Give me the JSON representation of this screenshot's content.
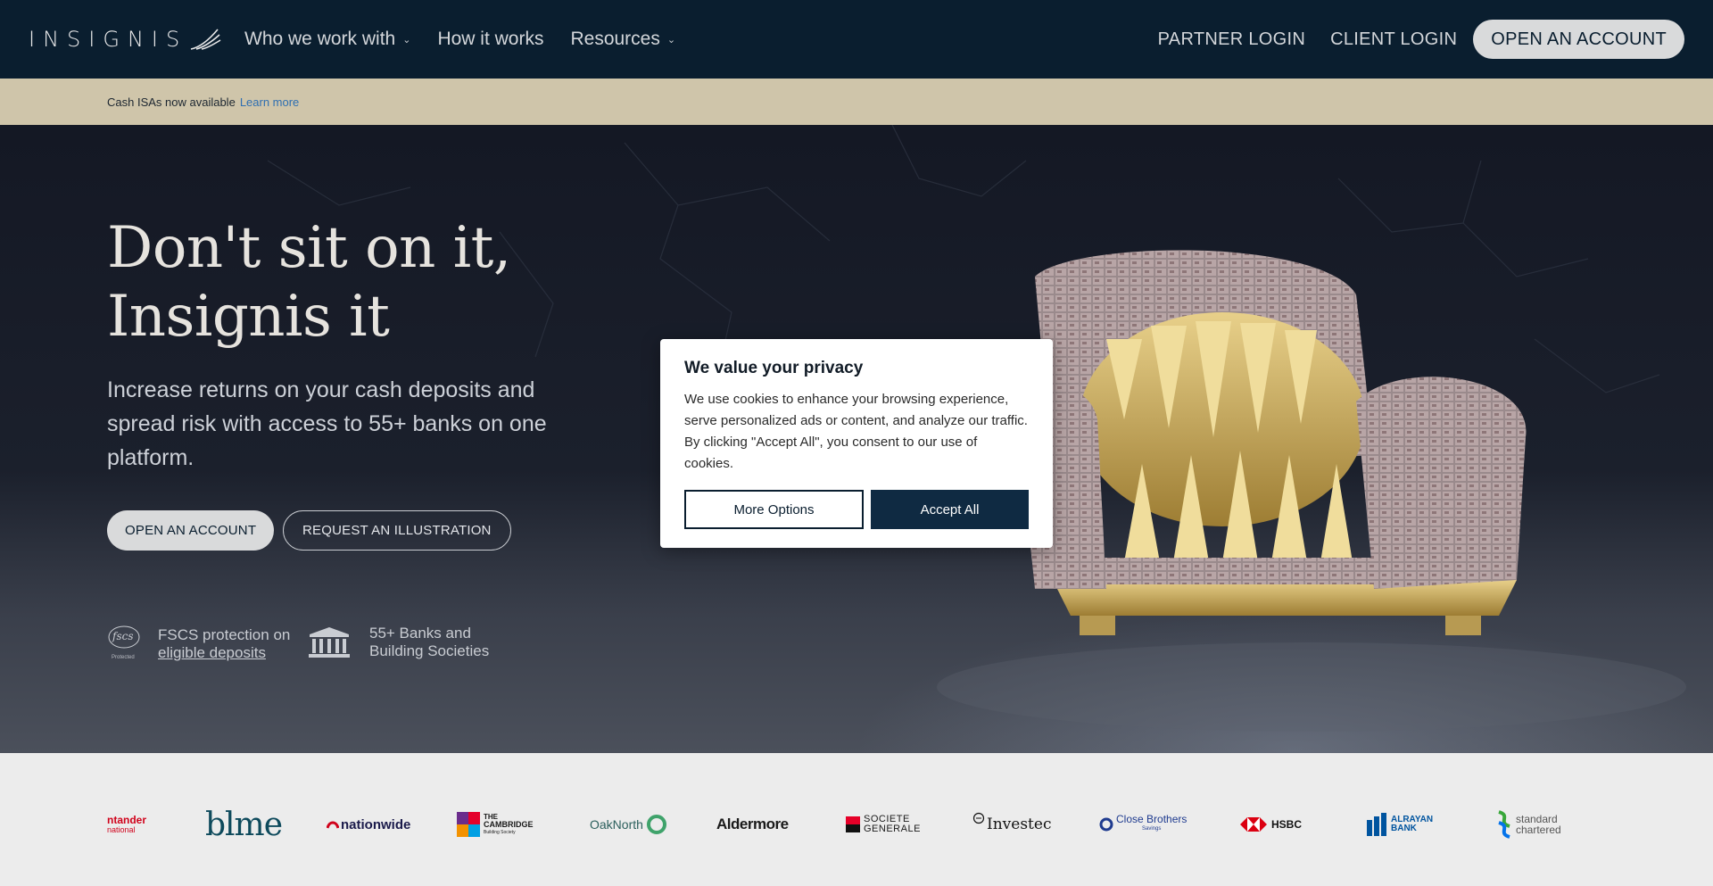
{
  "nav": {
    "logo": "INSIGNIS",
    "links": [
      {
        "label": "Who we work with",
        "has_dropdown": true
      },
      {
        "label": "How it works",
        "has_dropdown": false
      },
      {
        "label": "Resources",
        "has_dropdown": true
      }
    ],
    "partner_login": "PARTNER LOGIN",
    "client_login": "CLIENT LOGIN",
    "open_account": "OPEN AN ACCOUNT"
  },
  "banner": {
    "text": "Cash ISAs now available",
    "link": "Learn more"
  },
  "hero": {
    "headline_line1": "Don't sit on it,",
    "headline_line2": "Insignis it",
    "subhead": "Increase returns on your cash deposits and spread risk with access to 55+ banks on one platform.",
    "primary_cta": "OPEN AN ACCOUNT",
    "secondary_cta": "REQUEST AN ILLUSTRATION",
    "features": [
      {
        "icon": "fscs-protected-icon",
        "icon_text": "fscs",
        "icon_subtext": "Protected",
        "line1": "FSCS protection on",
        "link": "eligible deposits"
      },
      {
        "icon": "bank-building-icon",
        "line1": "55+ Banks and",
        "line2": "Building Societies"
      }
    ]
  },
  "cookie_modal": {
    "title": "We value your privacy",
    "body": "We use cookies to enhance your browsing experience, serve personalized ads or content, and analyze our traffic. By clicking \"Accept All\", you consent to our use of cookies.",
    "more_options": "More Options",
    "accept_all": "Accept All"
  },
  "banks": [
    {
      "name": "santander",
      "line1": "ntander",
      "line2": "national"
    },
    {
      "name": "blme",
      "line1": "blme"
    },
    {
      "name": "nationwide",
      "line1": "nationwide"
    },
    {
      "name": "cambridge",
      "line1": "THE",
      "line2": "CAMBRIDGE",
      "line3": "Building Society"
    },
    {
      "name": "oaknorth",
      "line1": "OakNorth"
    },
    {
      "name": "aldermore",
      "line1": "Aldermore"
    },
    {
      "name": "societe-generale",
      "line1": "SOCIETE",
      "line2": "GENERALE"
    },
    {
      "name": "investec",
      "line1": "Investec"
    },
    {
      "name": "close-brothers",
      "line1": "Close Brothers",
      "line2": "Savings"
    },
    {
      "name": "hsbc",
      "line1": "HSBC"
    },
    {
      "name": "alrayan",
      "line1": "ALRAYAN",
      "line2": "BANK"
    },
    {
      "name": "standard-chartered",
      "line1": "standard",
      "line2": "chartered"
    }
  ],
  "colors": {
    "nav_bg": "#0a1e2f",
    "banner_bg": "#cfc5aa",
    "accent_link": "#2f6fb1",
    "accept_bg": "#0f2a42"
  }
}
